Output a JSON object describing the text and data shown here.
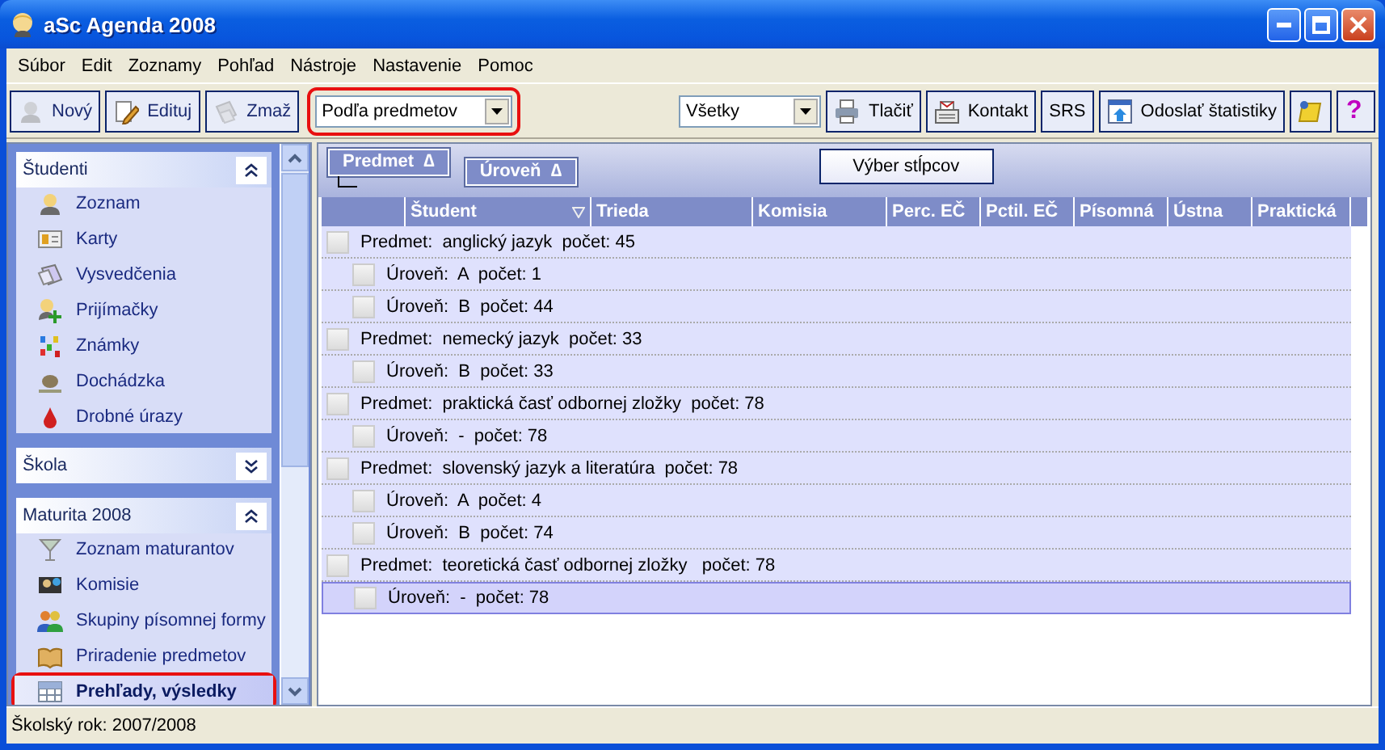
{
  "window": {
    "title": "aSc Agenda 2008"
  },
  "menu": [
    "Súbor",
    "Edit",
    "Zoznamy",
    "Pohľad",
    "Nástroje",
    "Nastavenie",
    "Pomoc"
  ],
  "toolbar": {
    "left": [
      {
        "label": "Nový",
        "disabled": true
      },
      {
        "label": "Edituj",
        "disabled": false
      },
      {
        "label": "Zmaž",
        "disabled": true
      }
    ],
    "view_select": {
      "value": "Podľa predmetov",
      "highlighted": true
    },
    "filter_select": {
      "value": "Všetky"
    },
    "right": [
      {
        "label": "Tlačiť"
      },
      {
        "label": "Kontakt"
      },
      {
        "label": "SRS"
      },
      {
        "label": "Odoslať štatistiky"
      }
    ],
    "help": "?"
  },
  "sidebar": [
    {
      "title": "Študenti",
      "expanded": true,
      "items": [
        {
          "label": "Zoznam",
          "selected": false,
          "highlighted": false
        },
        {
          "label": "Karty",
          "selected": false,
          "highlighted": false
        },
        {
          "label": "Vysvedčenia",
          "selected": false,
          "highlighted": false
        },
        {
          "label": "Prijímačky",
          "selected": false,
          "highlighted": false
        },
        {
          "label": "Známky",
          "selected": false,
          "highlighted": false
        },
        {
          "label": "Dochádzka",
          "selected": false,
          "highlighted": false
        },
        {
          "label": "Drobné úrazy",
          "selected": false,
          "highlighted": false
        }
      ]
    },
    {
      "title": "Škola",
      "expanded": false
    },
    {
      "title": "Maturita 2008",
      "expanded": true,
      "items": [
        {
          "label": "Zoznam maturantov",
          "selected": false,
          "highlighted": false
        },
        {
          "label": "Komisie",
          "selected": false,
          "highlighted": false
        },
        {
          "label": "Skupiny písomnej formy",
          "selected": false,
          "highlighted": false
        },
        {
          "label": "Priradenie predmetov",
          "selected": false,
          "highlighted": false
        },
        {
          "label": "Prehľady, výsledky",
          "selected": true,
          "highlighted": true
        }
      ]
    }
  ],
  "grid": {
    "group_by": [
      {
        "label": "Predmet",
        "sort": "∆"
      },
      {
        "label": "Úroveň",
        "sort": "∆"
      }
    ],
    "column_chooser": "Výber stĺpcov",
    "columns": [
      {
        "label": "Študent",
        "filter": true
      },
      {
        "label": "Trieda",
        "filter": false
      },
      {
        "label": "Komisia",
        "filter": false
      },
      {
        "label": "Perc. EČ",
        "filter": false
      },
      {
        "label": "Pctil. EČ",
        "filter": false
      },
      {
        "label": "Písomná",
        "filter": false
      },
      {
        "label": "Ústna",
        "filter": false
      },
      {
        "label": "Praktická",
        "filter": false
      }
    ],
    "rows": [
      {
        "text": "Predmet:  anglický jazyk  počet: 45",
        "selected": false,
        "children": [
          {
            "text": "Úroveň:  A  počet: 1",
            "selected": false
          },
          {
            "text": "Úroveň:  B  počet: 44",
            "selected": false
          }
        ]
      },
      {
        "text": "Predmet:  nemecký jazyk  počet: 33",
        "selected": false,
        "children": [
          {
            "text": "Úroveň:  B  počet: 33",
            "selected": false
          }
        ]
      },
      {
        "text": "Predmet:  praktická časť odbornej zložky  počet: 78",
        "selected": false,
        "children": [
          {
            "text": "Úroveň:  -  počet: 78",
            "selected": false
          }
        ]
      },
      {
        "text": "Predmet:  slovenský jazyk a literatúra  počet: 78",
        "selected": false,
        "children": [
          {
            "text": "Úroveň:  A  počet: 4",
            "selected": false
          },
          {
            "text": "Úroveň:  B  počet: 74",
            "selected": false
          }
        ]
      },
      {
        "text": "Predmet:  teoretická časť odbornej zložky   počet: 78",
        "selected": false,
        "children": [
          {
            "text": "Úroveň:  -  počet: 78",
            "selected": true
          }
        ]
      }
    ]
  },
  "status_bar": "Školský rok: 2007/2008"
}
